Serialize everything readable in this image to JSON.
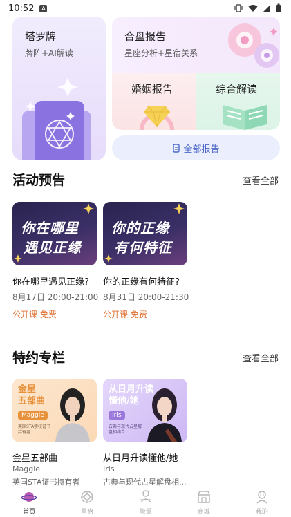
{
  "status_bar": {
    "time": "10:52",
    "app_indicator": "A"
  },
  "feature_cards": {
    "tarot": {
      "title": "塔罗牌",
      "subtitle": "牌阵+AI解读"
    },
    "hepan": {
      "title": "合盘报告",
      "subtitle": "星座分析+星宿关系"
    },
    "hunyin": {
      "title": "婚姻报告"
    },
    "zonghe": {
      "title": "综合解读"
    },
    "all_reports": {
      "label": "全部报告",
      "icon": "document-icon"
    }
  },
  "events": {
    "title": "活动预告",
    "see_all": "查看全部",
    "items": [
      {
        "thumb_line1": "你在哪里",
        "thumb_line2": "遇见正缘",
        "title": "你在哪里遇见正缘?",
        "date": "8月17日 20:00-21:00",
        "tag": "公开课 免费"
      },
      {
        "thumb_line1": "你的正缘",
        "thumb_line2": "有何特征",
        "title": "你的正缘有何特征?",
        "date": "8月31日 20:00-21:30",
        "tag": "公开课 免费"
      }
    ]
  },
  "columns": {
    "title": "特约专栏",
    "see_all": "查看全部",
    "items": [
      {
        "thumb_line1": "金星",
        "thumb_line2": "五部曲",
        "thumb_pill": "Maggie",
        "thumb_tiny": "英国STA学校证书持有者",
        "title": "金星五部曲",
        "author": "Maggie",
        "desc": "英国STA证书持有者"
      },
      {
        "thumb_line1": "从日月升读",
        "thumb_line2": "懂他/她",
        "thumb_pill": "Iris",
        "thumb_tiny": "古典与现代占星解盘相结合",
        "title": "从日月升读懂他/她",
        "author": "Iris",
        "desc": "古典与现代占星解盘相..."
      }
    ]
  },
  "tabbar": {
    "items": [
      {
        "label": "首页",
        "icon": "planet-icon",
        "active": true
      },
      {
        "label": "星盘",
        "icon": "chart-wheel-icon",
        "active": false
      },
      {
        "label": "能量",
        "icon": "energy-icon",
        "active": false
      },
      {
        "label": "商城",
        "icon": "shop-icon",
        "active": false
      },
      {
        "label": "我的",
        "icon": "profile-icon",
        "active": false
      }
    ]
  },
  "colors": {
    "accent_orange": "#e07030",
    "accent_blue": "#4a67c8"
  }
}
